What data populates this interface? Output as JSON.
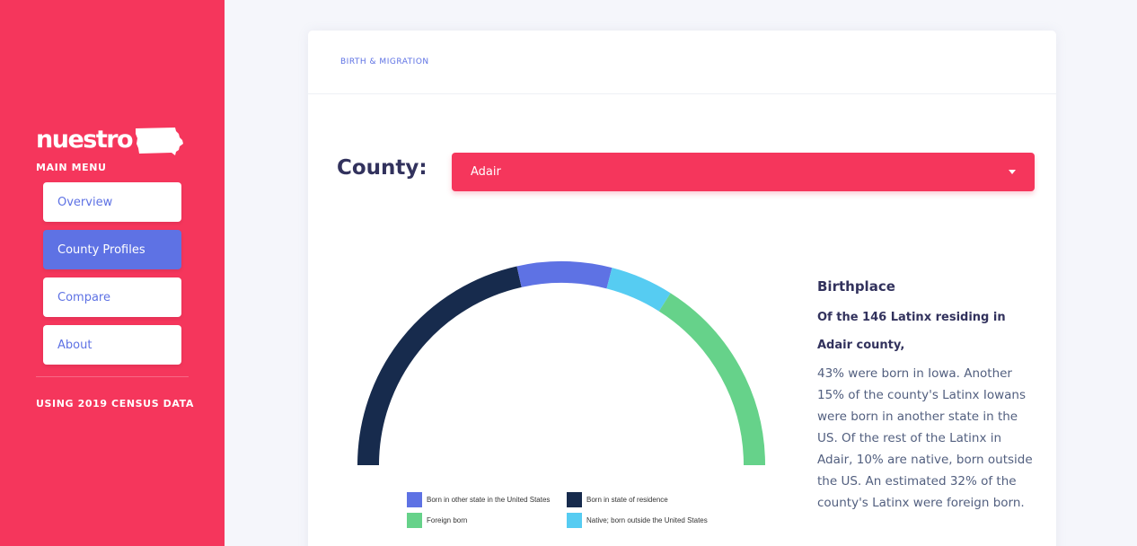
{
  "sidebar": {
    "logo_text": "nuestro",
    "menu_heading": "MAIN MENU",
    "items": [
      {
        "label": "Overview",
        "active": false
      },
      {
        "label": "County Profiles",
        "active": true
      },
      {
        "label": "Compare",
        "active": false
      },
      {
        "label": "About",
        "active": false
      }
    ],
    "census_note": "USING 2019 CENSUS DATA"
  },
  "card": {
    "section_label": "BIRTH & MIGRATION",
    "county_label": "County:",
    "county_select": {
      "value": "Adair"
    }
  },
  "info": {
    "title": "Birthplace",
    "lead": "Of the 146 Latinx residing in Adair county,",
    "body": "43% were born in Iowa. Another 15% of the county's Latinx Iowans were born in another state in the US. Of the rest of the Latinx in Adair, 10% are native, born outside the US. An estimated 32% of the county's Latinx were foreign born."
  },
  "chart_data": {
    "type": "pie",
    "variant": "semicircle-donut",
    "series": [
      {
        "name": "Born in state of residence",
        "value": 43,
        "color": "#172b4d"
      },
      {
        "name": "Born in other state in the United States",
        "value": 15,
        "color": "#5e72e4"
      },
      {
        "name": "Native; born outside the United States",
        "value": 10,
        "color": "#56ccf2"
      },
      {
        "name": "Foreign born",
        "value": 32,
        "color": "#66d28a"
      }
    ],
    "legend": [
      {
        "name": "Born in other state in the United States",
        "color": "#5e72e4"
      },
      {
        "name": "Born in state of residence",
        "color": "#172b4d"
      },
      {
        "name": "Foreign born",
        "color": "#66d28a"
      },
      {
        "name": "Native; born outside the United States",
        "color": "#56ccf2"
      }
    ],
    "legend_placement": "bottom"
  },
  "colors": {
    "brand": "#f5365c",
    "accent": "#5e72e4"
  }
}
